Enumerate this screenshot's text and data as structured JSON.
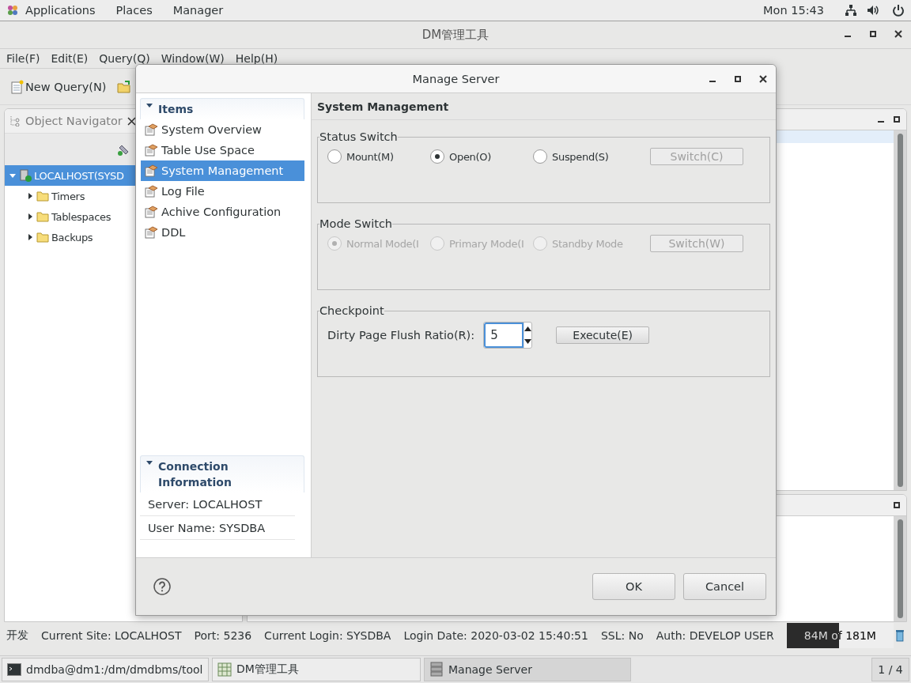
{
  "top_bar": {
    "menus": [
      "Applications",
      "Places",
      "Manager"
    ],
    "clock": "Mon 15:43"
  },
  "main_window": {
    "title": "DM管理工具",
    "menu": [
      "File(F)",
      "Edit(E)",
      "Query(Q)",
      "Window(W)",
      "Help(H)"
    ],
    "toolbar": [
      {
        "label": "New Query(N)"
      }
    ],
    "navigator": {
      "title": "Object Navigator",
      "tree": [
        {
          "label": "LOCALHOST(SYSD",
          "expanded": true,
          "selected": true,
          "children": [
            {
              "label": "Timers",
              "expanded": false,
              "selected": false
            },
            {
              "label": "Tablespaces",
              "expanded": false,
              "selected": false
            },
            {
              "label": "Backups",
              "expanded": false,
              "selected": false
            }
          ]
        }
      ]
    }
  },
  "dialog": {
    "title": "Manage Server",
    "items_section": {
      "title": "Items",
      "expanded": true,
      "items": [
        {
          "label": "System Overview",
          "selected": false
        },
        {
          "label": "Table Use Space",
          "selected": false
        },
        {
          "label": "System Management",
          "selected": true
        },
        {
          "label": "Log File",
          "selected": false
        },
        {
          "label": "Achive Configuration",
          "selected": false
        },
        {
          "label": "DDL",
          "selected": false
        }
      ]
    },
    "connection_section": {
      "title": "Connection Information",
      "expanded": true,
      "rows": [
        "Server: LOCALHOST",
        "User Name: SYSDBA"
      ]
    },
    "page_title": "System Management",
    "groups": [
      {
        "kind": "radio",
        "title": "Status Switch",
        "options": [
          {
            "label": "Mount(M)",
            "selected": false,
            "disabled": false
          },
          {
            "label": "Open(O)",
            "selected": true,
            "disabled": false
          },
          {
            "label": "Suspend(S)",
            "selected": false,
            "disabled": false
          }
        ],
        "button": {
          "label": "Switch(C)",
          "disabled": true
        }
      },
      {
        "kind": "radio",
        "title": "Mode Switch",
        "options": [
          {
            "label": "Normal Mode(I",
            "selected": true,
            "disabled": true
          },
          {
            "label": "Primary Mode(I",
            "selected": false,
            "disabled": true
          },
          {
            "label": "Standby Mode",
            "selected": false,
            "disabled": true
          }
        ],
        "button": {
          "label": "Switch(W)",
          "disabled": true
        }
      },
      {
        "kind": "spinner",
        "title": "Checkpoint",
        "label": "Dirty Page Flush Ratio(R):",
        "value": "5",
        "button": {
          "label": "Execute(E)",
          "disabled": false
        }
      }
    ],
    "buttons": [
      "OK",
      "Cancel"
    ]
  },
  "status_bar": [
    "开发",
    "Current Site: LOCALHOST",
    "Port: 5236",
    "Current Login: SYSDBA",
    "Login Date: 2020-03-02 15:40:51",
    "SSL: No",
    "Auth: DEVELOP USER"
  ],
  "memory": {
    "reading": "84M of 181M",
    "level": 0.49
  },
  "taskbar": [
    {
      "label": "dmdba@dm1:/dm/dmdbms/tool",
      "kind": "terminal",
      "selected": false
    },
    {
      "label": "DM管理工具",
      "kind": "app",
      "selected": false
    },
    {
      "label": "Manage Server",
      "kind": "server",
      "selected": true
    }
  ],
  "workspace": "1 / 4"
}
